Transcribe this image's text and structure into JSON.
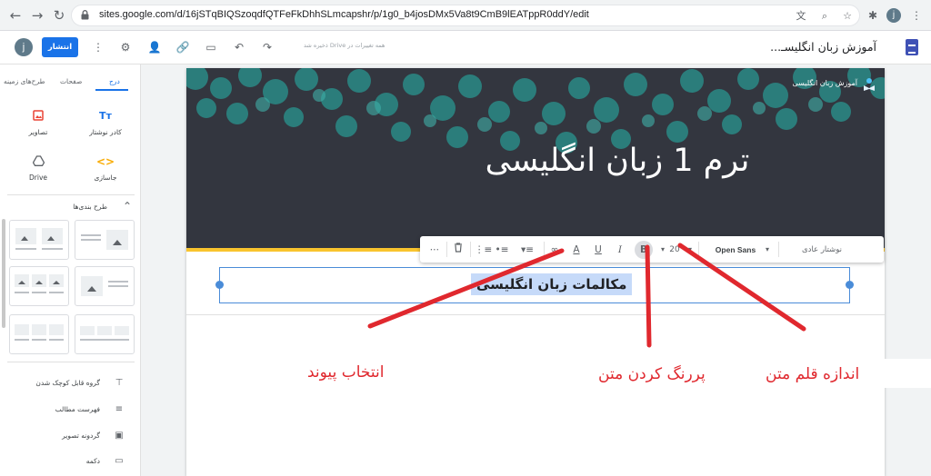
{
  "browser": {
    "url": "sites.google.com/d/16jSTqBIQSzoqdfQTFeFkDhhSLmcapshr/p/1g0_b4josDMx5Va8t9CmB9lEATppR0ddY/edit",
    "profile_initial": "j"
  },
  "appbar": {
    "publish_label": "انتشار",
    "saved_status": "همه تغییرات در Drive ذخیره شد",
    "site_title": "آموزش زبان انگلیسـ...",
    "profile_initial": "j"
  },
  "sidebar": {
    "tabs": [
      "درج",
      "صفحات",
      "طرح‌های زمینه"
    ],
    "insert_items": [
      {
        "label": "کادر نوشتار",
        "icon": "text-box-icon"
      },
      {
        "label": "تصاویر",
        "icon": "images-icon"
      },
      {
        "label": "جاسازی",
        "icon": "embed-icon"
      },
      {
        "label": "Drive",
        "icon": "drive-icon"
      }
    ],
    "layouts_title": "طرح بندی‌ها",
    "bottom_items": [
      {
        "label": "گروه قابل کوچک شدن",
        "icon": "collapsible-group-icon"
      },
      {
        "label": "فهرست مطالب",
        "icon": "table-of-contents-icon"
      },
      {
        "label": "گردونه تصویر",
        "icon": "image-carousel-icon"
      },
      {
        "label": "دکمه",
        "icon": "button-icon"
      }
    ]
  },
  "page": {
    "brand": "آموزش زبان انگلیسی",
    "hero_title": "ترم 1 زبان انگلیسی",
    "selected_text": "مکالمات زبان انگلیسی"
  },
  "format_toolbar": {
    "style": "نوشتار عادی",
    "font": "Open Sans",
    "size": "20",
    "bold": "B",
    "italic": "I",
    "underline": "U",
    "text_color": "A"
  },
  "annotations": {
    "link": "انتخاب پیوند",
    "bold": "پررنگ کردن متن",
    "size": "اندازه قلم متن"
  },
  "colors": {
    "accent": "#1a73e8",
    "header_bg": "#33363f",
    "header_stripe": "#f9c42e",
    "selection": "#c6daf9",
    "annotation": "#e0282e"
  }
}
